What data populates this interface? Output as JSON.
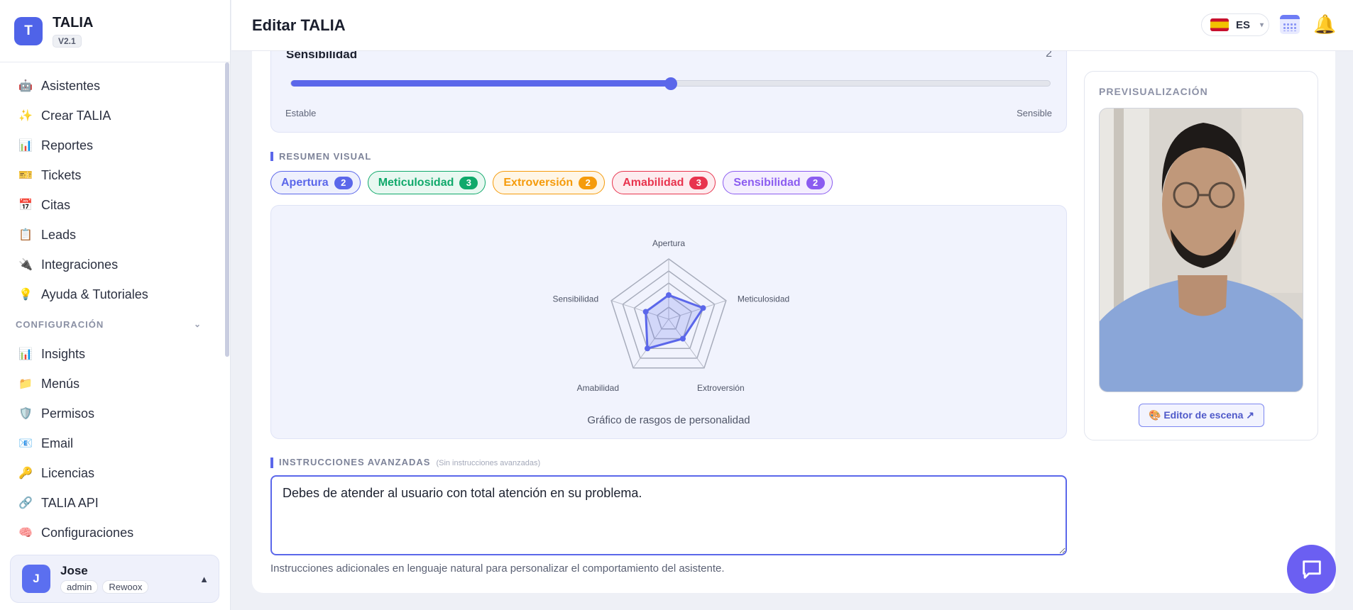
{
  "brand": {
    "name": "TALIA",
    "logo_letter": "T",
    "version": "V2.1"
  },
  "sidebar": {
    "items": [
      {
        "label": "Asistentes",
        "icon": "robot-icon"
      },
      {
        "label": "Crear TALIA",
        "icon": "sparkles-icon"
      },
      {
        "label": "Reportes",
        "icon": "bar-chart-icon"
      },
      {
        "label": "Tickets",
        "icon": "ticket-icon"
      },
      {
        "label": "Citas",
        "icon": "calendar-icon"
      },
      {
        "label": "Leads",
        "icon": "clipboard-icon"
      },
      {
        "label": "Integraciones",
        "icon": "plug-icon"
      },
      {
        "label": "Ayuda & Tutoriales",
        "icon": "lightbulb-icon"
      }
    ],
    "section": "CONFIGURACIÓN",
    "config_items": [
      {
        "label": "Insights",
        "icon": "bar-chart-icon"
      },
      {
        "label": "Menús",
        "icon": "folder-icon"
      },
      {
        "label": "Permisos",
        "icon": "shield-icon"
      },
      {
        "label": "Email",
        "icon": "email-icon"
      },
      {
        "label": "Licencias",
        "icon": "key-icon"
      },
      {
        "label": "TALIA API",
        "icon": "link-icon"
      },
      {
        "label": "Configuraciones",
        "icon": "brain-icon"
      }
    ]
  },
  "user": {
    "name": "Jose",
    "initial": "J",
    "role": "admin",
    "org": "Rewoox"
  },
  "header": {
    "title": "Editar TALIA",
    "language": "ES"
  },
  "sensitivity": {
    "label": "Sensibilidad",
    "value": "2",
    "fraction": 0.5,
    "min_label": "Estable",
    "max_label": "Sensible"
  },
  "visual_summary": {
    "title": "RESUMEN VISUAL",
    "traits": [
      {
        "name": "Apertura",
        "value": "2",
        "color": "#5b67ea",
        "bg": "#eef0fd"
      },
      {
        "name": "Meticulosidad",
        "value": "3",
        "color": "#10a96b",
        "bg": "#e8f8f1"
      },
      {
        "name": "Extroversión",
        "value": "2",
        "color": "#f59b0b",
        "bg": "#fff6e6"
      },
      {
        "name": "Amabilidad",
        "value": "3",
        "color": "#e8344e",
        "bg": "#fdecef"
      },
      {
        "name": "Sensibilidad",
        "value": "2",
        "color": "#8b5cf0",
        "bg": "#f4eefe"
      }
    ]
  },
  "chart_data": {
    "type": "radar",
    "categories": [
      "Apertura",
      "Meticulosidad",
      "Extroversión",
      "Amabilidad",
      "Sensibilidad"
    ],
    "values": [
      2,
      3,
      2,
      3,
      2
    ],
    "max": 5,
    "caption": "Gráfico de rasgos de personalidad",
    "color": "#5b67ea"
  },
  "advanced": {
    "title": "INSTRUCCIONES AVANZADAS",
    "hint": "(Sin instrucciones avanzadas)",
    "value": "Debes de atender al usuario con total atención en su problema.",
    "help": "Instrucciones adicionales en lenguaje natural para personalizar el comportamiento del asistente."
  },
  "preview": {
    "title": "PREVISUALIZACIÓN",
    "scene_button": "🎨 Editor de escena ↗"
  }
}
